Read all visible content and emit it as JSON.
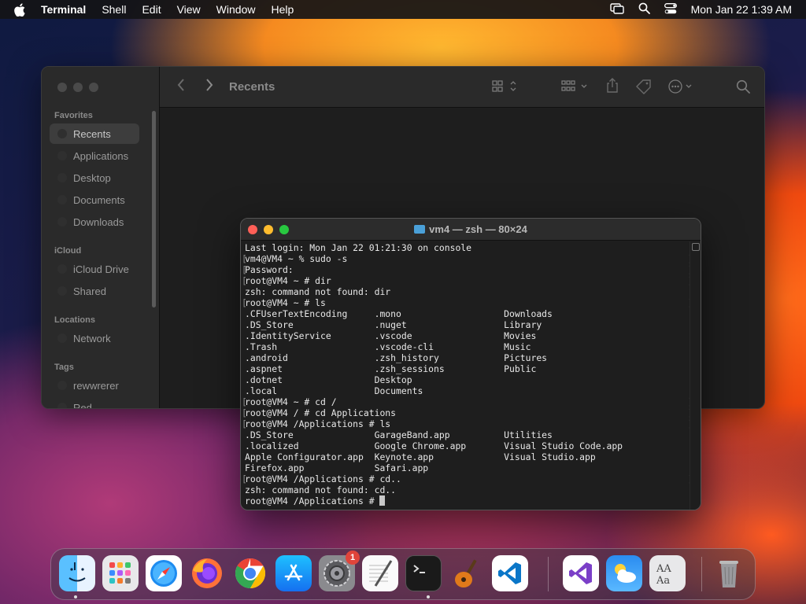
{
  "menubar": {
    "app_name": "Terminal",
    "menus": [
      "Shell",
      "Edit",
      "View",
      "Window",
      "Help"
    ],
    "clock": "Mon Jan 22  1:39 AM"
  },
  "finder": {
    "title": "Recents",
    "sections": {
      "favorites": "Favorites",
      "icloud": "iCloud",
      "locations": "Locations",
      "tags": "Tags"
    },
    "favorites": [
      "Recents",
      "Applications",
      "Desktop",
      "Documents",
      "Downloads"
    ],
    "icloud": [
      "iCloud Drive",
      "Shared"
    ],
    "locations": [
      "Network"
    ],
    "tags": [
      "rewwrerer",
      "Red"
    ]
  },
  "terminal": {
    "title": "vm4 — zsh — 80×24",
    "lines": [
      {
        "text": "Last login: Mon Jan 22 01:21:30 on console",
        "bracket": false
      },
      {
        "text": "vm4@VM4 ~ % sudo -s",
        "bracket": true
      },
      {
        "text": "Password:",
        "bracket": true
      },
      {
        "text": "root@VM4 ~ # dir",
        "bracket": true
      },
      {
        "text": "zsh: command not found: dir",
        "bracket": false
      },
      {
        "text": "root@VM4 ~ # ls",
        "bracket": true
      },
      {
        "text": ".CFUserTextEncoding     .mono                   Downloads",
        "bracket": false
      },
      {
        "text": ".DS_Store               .nuget                  Library",
        "bracket": false
      },
      {
        "text": ".IdentityService        .vscode                 Movies",
        "bracket": false
      },
      {
        "text": ".Trash                  .vscode-cli             Music",
        "bracket": false
      },
      {
        "text": ".android                .zsh_history            Pictures",
        "bracket": false
      },
      {
        "text": ".aspnet                 .zsh_sessions           Public",
        "bracket": false
      },
      {
        "text": ".dotnet                 Desktop",
        "bracket": false
      },
      {
        "text": ".local                  Documents",
        "bracket": false
      },
      {
        "text": "root@VM4 ~ # cd /",
        "bracket": true
      },
      {
        "text": "root@VM4 / # cd Applications",
        "bracket": true
      },
      {
        "text": "root@VM4 /Applications # ls",
        "bracket": true
      },
      {
        "text": ".DS_Store               GarageBand.app          Utilities",
        "bracket": false
      },
      {
        "text": ".localized              Google Chrome.app       Visual Studio Code.app",
        "bracket": false
      },
      {
        "text": "Apple Configurator.app  Keynote.app             Visual Studio.app",
        "bracket": false
      },
      {
        "text": "Firefox.app             Safari.app",
        "bracket": false
      },
      {
        "text": "root@VM4 /Applications # cd..",
        "bracket": true
      },
      {
        "text": "zsh: command not found: cd..",
        "bracket": false
      },
      {
        "text": "root@VM4 /Applications # ",
        "bracket": false,
        "cursor": true
      }
    ]
  },
  "dock": {
    "apps": [
      {
        "name": "Finder",
        "running": true
      },
      {
        "name": "Launchpad",
        "running": false
      },
      {
        "name": "Safari",
        "running": false
      },
      {
        "name": "Firefox",
        "running": false
      },
      {
        "name": "Google Chrome",
        "running": false
      },
      {
        "name": "App Store",
        "running": false
      },
      {
        "name": "System Settings",
        "running": false,
        "badge": "1"
      },
      {
        "name": "TextEdit",
        "running": false
      },
      {
        "name": "Terminal",
        "running": true
      },
      {
        "name": "GarageBand",
        "running": false
      },
      {
        "name": "Visual Studio Code",
        "running": false
      },
      {
        "name": "Visual Studio",
        "running": false
      },
      {
        "name": "Weather",
        "running": false
      },
      {
        "name": "Font Book",
        "running": false
      },
      {
        "name": "Trash",
        "running": false
      }
    ]
  }
}
